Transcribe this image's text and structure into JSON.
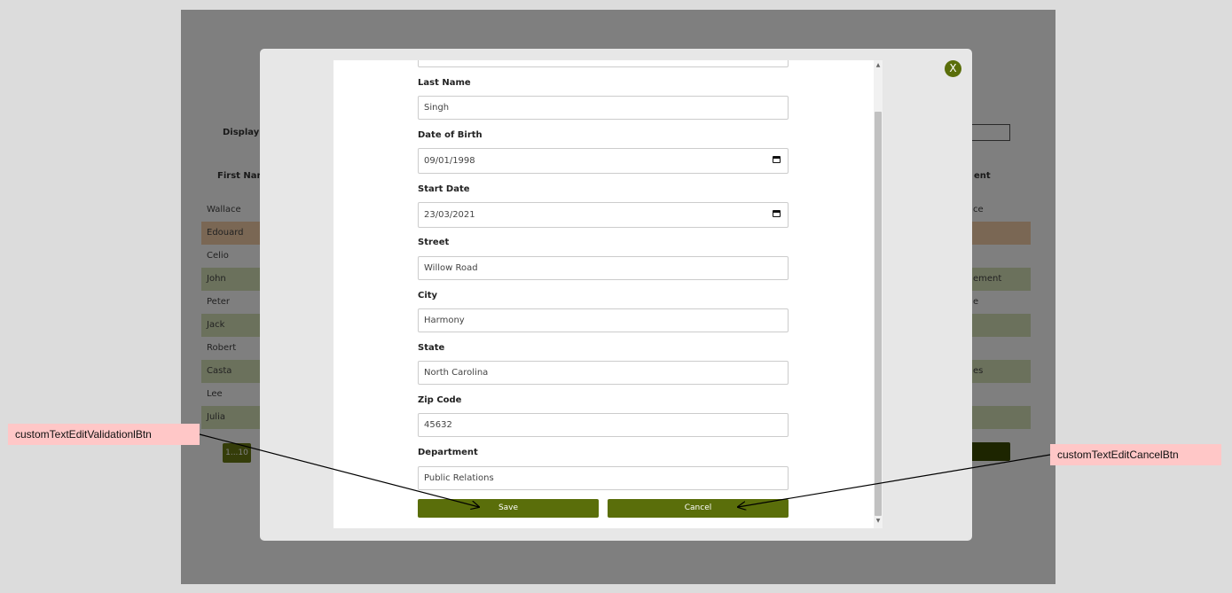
{
  "background": {
    "display_label": "Display E",
    "first_name_header": "First Nam",
    "right_header": "ent",
    "rows": [
      {
        "name": "Wallace",
        "right": "ce",
        "highlight": "none"
      },
      {
        "name": "Edouard",
        "right": "",
        "highlight": "orange"
      },
      {
        "name": "Celio",
        "right": "",
        "highlight": "none"
      },
      {
        "name": "John",
        "right": "ement",
        "highlight": "green"
      },
      {
        "name": "Peter",
        "right": "e",
        "highlight": "none"
      },
      {
        "name": "Jack",
        "right": "",
        "highlight": "green"
      },
      {
        "name": "Robert",
        "right": "",
        "highlight": "none"
      },
      {
        "name": "Casta",
        "right": "es",
        "highlight": "green"
      },
      {
        "name": "Lee",
        "right": "",
        "highlight": "none"
      },
      {
        "name": "Julia",
        "right": "",
        "highlight": "green"
      }
    ],
    "pager_label": "1...10"
  },
  "modal": {
    "close_label": "X",
    "fields": [
      {
        "label": "Last Name",
        "value": "Singh",
        "type": "text"
      },
      {
        "label": "Date of Birth",
        "value": "09/01/1998",
        "type": "date"
      },
      {
        "label": "Start Date",
        "value": "23/03/2021",
        "type": "date"
      },
      {
        "label": "Street",
        "value": "Willow Road",
        "type": "text"
      },
      {
        "label": "City",
        "value": "Harmony",
        "type": "text"
      },
      {
        "label": "State",
        "value": "North Carolina",
        "type": "text"
      },
      {
        "label": "Zip Code",
        "value": "45632",
        "type": "text"
      },
      {
        "label": "Department",
        "value": "Public Relations",
        "type": "text"
      }
    ],
    "save_label": "Save",
    "cancel_label": "Cancel"
  },
  "annotations": {
    "left": "customTextEditValidationlBtn",
    "right": "customTextEditCancelBtn"
  },
  "colors": {
    "accent": "#5a6e0a",
    "annotation_bg": "#ffc7c7"
  }
}
